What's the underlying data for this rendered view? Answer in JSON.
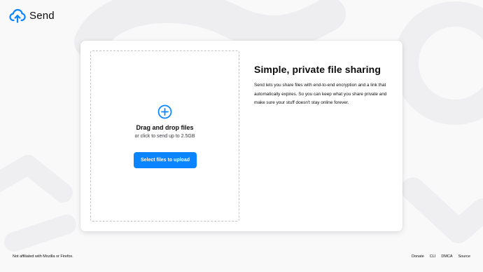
{
  "header": {
    "brand": "Send",
    "logo_icon": "cloud-upload-icon"
  },
  "upload": {
    "icon": "plus-circle-icon",
    "title": "Drag and drop files",
    "subtitle": "or click to send up to 2.5GB",
    "button_label": "Select files to upload"
  },
  "intro": {
    "title": "Simple, private file sharing",
    "body": "Send lets you share files with end-to-end encryption and a link that automatically expires. So you can keep what you share private and make sure your stuff doesn't stay online forever."
  },
  "footer": {
    "disclaimer": "Not affiliated with Mozilla or Firefox.",
    "links": [
      "Donate",
      "CLI",
      "DMCA",
      "Source"
    ]
  },
  "colors": {
    "accent": "#0a84ff",
    "background": "#f9f9fa",
    "card": "#ffffff"
  }
}
